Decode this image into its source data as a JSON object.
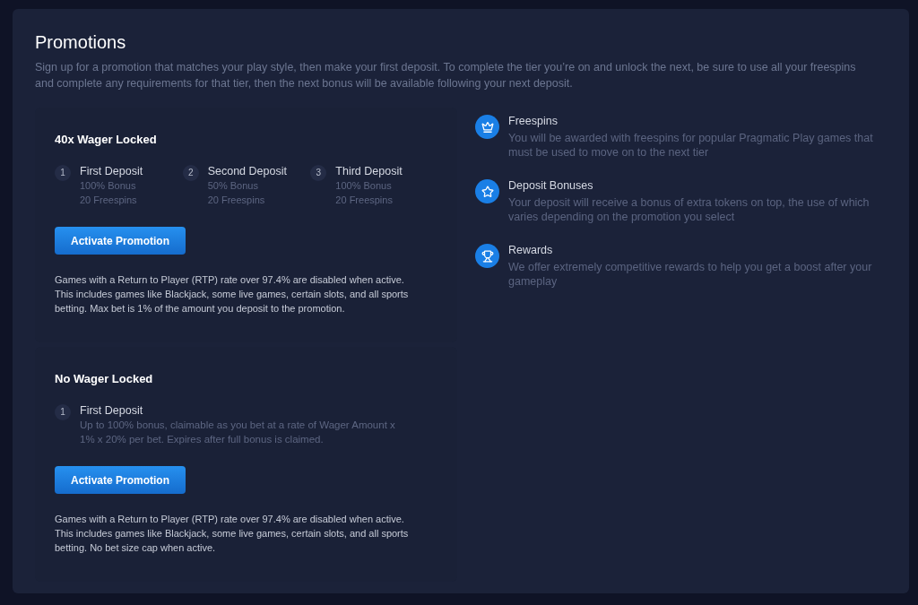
{
  "page": {
    "title": "Promotions",
    "description": "Sign up for a promotion that matches your play style, then make your first deposit. To complete the tier you’re on and unlock the next, be sure to use all your freespins and complete any requirements for that tier, then the next bonus will be available following your next deposit."
  },
  "promotions": [
    {
      "title": "40x Wager Locked",
      "steps": [
        {
          "number": "1",
          "title": "First Deposit",
          "details": [
            "100% Bonus",
            "20 Freespins"
          ]
        },
        {
          "number": "2",
          "title": "Second Deposit",
          "details": [
            "50% Bonus",
            "20 Freespins"
          ]
        },
        {
          "number": "3",
          "title": "Third Deposit",
          "details": [
            "100% Bonus",
            "20 Freespins"
          ]
        }
      ],
      "button": "Activate Promotion",
      "note": [
        "Games with a Return to Player (RTP) rate over 97.4% are disabled when active.",
        "This includes games like Blackjack, some live games, certain slots, and all sports betting. Max bet is 1% of the amount you deposit to the promotion."
      ]
    },
    {
      "title": "No Wager Locked",
      "steps": [
        {
          "number": "1",
          "title": "First Deposit",
          "details": [
            "Up to 100% bonus, claimable as you bet at a rate of Wager Amount x 1% x 20% per bet. Expires after full bonus is claimed."
          ]
        }
      ],
      "button": "Activate Promotion",
      "note": [
        "Games with a Return to Player (RTP) rate over 97.4% are disabled when active.",
        "This includes games like Blackjack, some live games, certain slots, and all sports betting. No bet size cap when active."
      ]
    }
  ],
  "features": [
    {
      "kind": "crown",
      "title": "Freespins",
      "description": "You will be awarded with freespins for popular Pragmatic Play games that must be used to move on to the next tier"
    },
    {
      "kind": "star",
      "title": "Deposit Bonuses",
      "description": "Your deposit will receive a bonus of extra tokens on top, the use of which varies depending on the promotion you select"
    },
    {
      "kind": "trophy",
      "title": "Rewards",
      "description": "We offer extremely competitive rewards to help you get a boost after your gameplay"
    }
  ]
}
